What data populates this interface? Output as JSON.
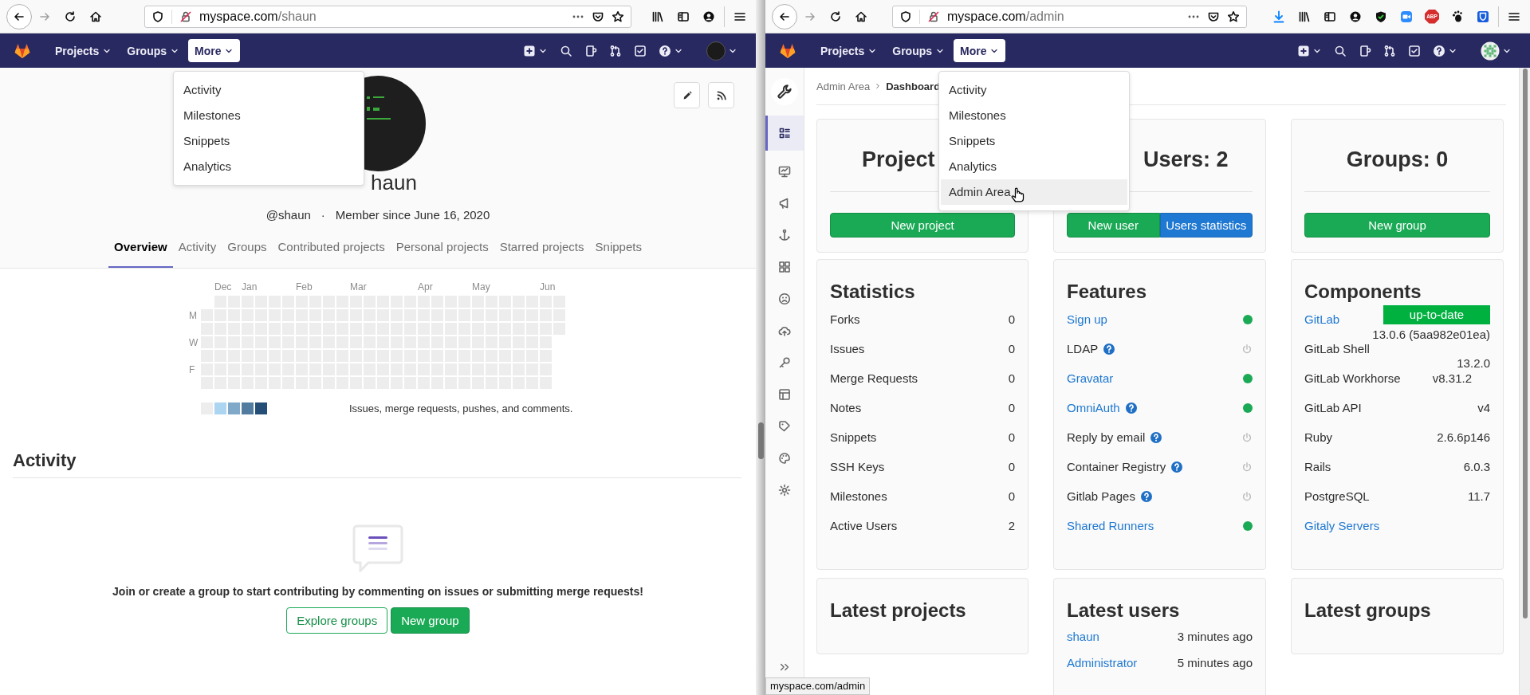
{
  "left_window": {
    "browser": {
      "url_host": "myspace.com",
      "url_path": "/shaun"
    },
    "navbar": {
      "menus": [
        {
          "label": "Projects",
          "open": false
        },
        {
          "label": "Groups",
          "open": false
        },
        {
          "label": "More",
          "open": true
        }
      ]
    },
    "more_menu": {
      "items": [
        {
          "label": "Activity",
          "highlighted": false
        },
        {
          "label": "Milestones",
          "highlighted": false
        },
        {
          "label": "Snippets",
          "highlighted": false
        },
        {
          "label": "Analytics",
          "highlighted": false
        }
      ]
    },
    "profile": {
      "name": "haun",
      "handle": "@shaun",
      "separator": "·",
      "member_since": "Member since June 16, 2020",
      "tabs": [
        {
          "label": "Overview",
          "selected": true
        },
        {
          "label": "Activity",
          "selected": false
        },
        {
          "label": "Groups",
          "selected": false
        },
        {
          "label": "Contributed projects",
          "selected": false
        },
        {
          "label": "Personal projects",
          "selected": false
        },
        {
          "label": "Starred projects",
          "selected": false
        },
        {
          "label": "Snippets",
          "selected": false
        }
      ]
    },
    "calendar": {
      "months": [
        "Dec",
        "Jan",
        "Feb",
        "Mar",
        "Apr",
        "May",
        "Jun"
      ],
      "days": [
        "M",
        "W",
        "F"
      ],
      "legend_text": "Issues, merge requests, pushes, and comments."
    },
    "activity": {
      "title": "Activity",
      "message": "Join or create a group to start contributing by commenting on issues or submitting merge requests!",
      "buttons": [
        {
          "label": "Explore groups",
          "kind": "outline"
        },
        {
          "label": "New group",
          "kind": "primary"
        }
      ]
    }
  },
  "right_window": {
    "browser": {
      "url_host": "myspace.com",
      "url_path": "/admin",
      "adblock_label": "ABP"
    },
    "navbar": {
      "menus": [
        {
          "label": "Projects",
          "open": false
        },
        {
          "label": "Groups",
          "open": false
        },
        {
          "label": "More",
          "open": true
        }
      ]
    },
    "more_menu": {
      "items": [
        {
          "label": "Activity",
          "highlighted": false
        },
        {
          "label": "Milestones",
          "highlighted": false
        },
        {
          "label": "Snippets",
          "highlighted": false
        },
        {
          "label": "Analytics",
          "highlighted": false
        },
        {
          "label": "Admin Area",
          "highlighted": true
        }
      ]
    },
    "sidebar": {
      "items": [
        {
          "selected": true
        },
        {
          "selected": false
        },
        {
          "selected": false
        },
        {
          "selected": false
        },
        {
          "selected": false
        },
        {
          "selected": false
        },
        {
          "selected": false
        },
        {
          "selected": false
        },
        {
          "selected": false
        },
        {
          "selected": false
        },
        {
          "selected": false
        },
        {
          "selected": false
        }
      ]
    },
    "breadcrumb": [
      {
        "label": "Admin Area",
        "current": false
      },
      {
        "label": "Dashboard",
        "current": true
      }
    ],
    "summary_cards": [
      {
        "title": "Project",
        "buttons": [
          {
            "label": "New project",
            "kind": "primary"
          }
        ]
      },
      {
        "title": "Users: 2",
        "buttons": [
          {
            "label": "New user",
            "kind": "primary"
          },
          {
            "label": "Users statistics",
            "kind": "info"
          }
        ]
      },
      {
        "title": "Groups: 0",
        "buttons": [
          {
            "label": "New group",
            "kind": "primary"
          }
        ]
      }
    ],
    "statistics": {
      "title": "Statistics",
      "rows": [
        {
          "label": "Forks",
          "value": "0"
        },
        {
          "label": "Issues",
          "value": "0"
        },
        {
          "label": "Merge Requests",
          "value": "0"
        },
        {
          "label": "Notes",
          "value": "0"
        },
        {
          "label": "Snippets",
          "value": "0"
        },
        {
          "label": "SSH Keys",
          "value": "0"
        },
        {
          "label": "Milestones",
          "value": "0"
        },
        {
          "label": "Active Users",
          "value": "2"
        }
      ]
    },
    "features": {
      "title": "Features",
      "rows": [
        {
          "label": "Sign up",
          "link": true,
          "help": false,
          "enabled": true
        },
        {
          "label": "LDAP",
          "link": false,
          "help": true,
          "enabled": false
        },
        {
          "label": "Gravatar",
          "link": true,
          "help": false,
          "enabled": true
        },
        {
          "label": "OmniAuth",
          "link": true,
          "help": true,
          "enabled": true
        },
        {
          "label": "Reply by email",
          "link": false,
          "help": true,
          "enabled": false
        },
        {
          "label": "Container Registry",
          "link": false,
          "help": true,
          "enabled": false
        },
        {
          "label": "Gitlab Pages",
          "link": false,
          "help": true,
          "enabled": false
        },
        {
          "label": "Shared Runners",
          "link": true,
          "help": false,
          "enabled": true
        }
      ]
    },
    "components": {
      "title": "Components",
      "rows": [
        {
          "name": "GitLab",
          "link": true,
          "kind": "stacked",
          "badge": "up-to-date",
          "value": "13.0.6 (5aa982e01ea)"
        },
        {
          "name": "GitLab Shell",
          "link": false,
          "kind": "lowered",
          "value": "13.2.0"
        },
        {
          "name": "GitLab Workhorse",
          "link": false,
          "kind": "inset",
          "value": "v8.31.2"
        },
        {
          "name": "GitLab API",
          "link": false,
          "kind": "plain",
          "value": "v4"
        },
        {
          "name": "Ruby",
          "link": false,
          "kind": "plain",
          "value": "2.6.6p146"
        },
        {
          "name": "Rails",
          "link": false,
          "kind": "plain",
          "value": "6.0.3"
        },
        {
          "name": "PostgreSQL",
          "link": false,
          "kind": "plain",
          "value": "11.7"
        },
        {
          "name": "Gitaly Servers",
          "link": true,
          "kind": "plain"
        }
      ]
    },
    "latest_projects": {
      "title": "Latest projects"
    },
    "latest_users": {
      "title": "Latest users",
      "rows": [
        {
          "name": "shaun",
          "time": "3 minutes ago"
        },
        {
          "name": "Administrator",
          "time": "5 minutes ago"
        }
      ]
    },
    "latest_groups": {
      "title": "Latest groups"
    },
    "status_bar": {
      "text": "myspace.com/admin"
    }
  }
}
